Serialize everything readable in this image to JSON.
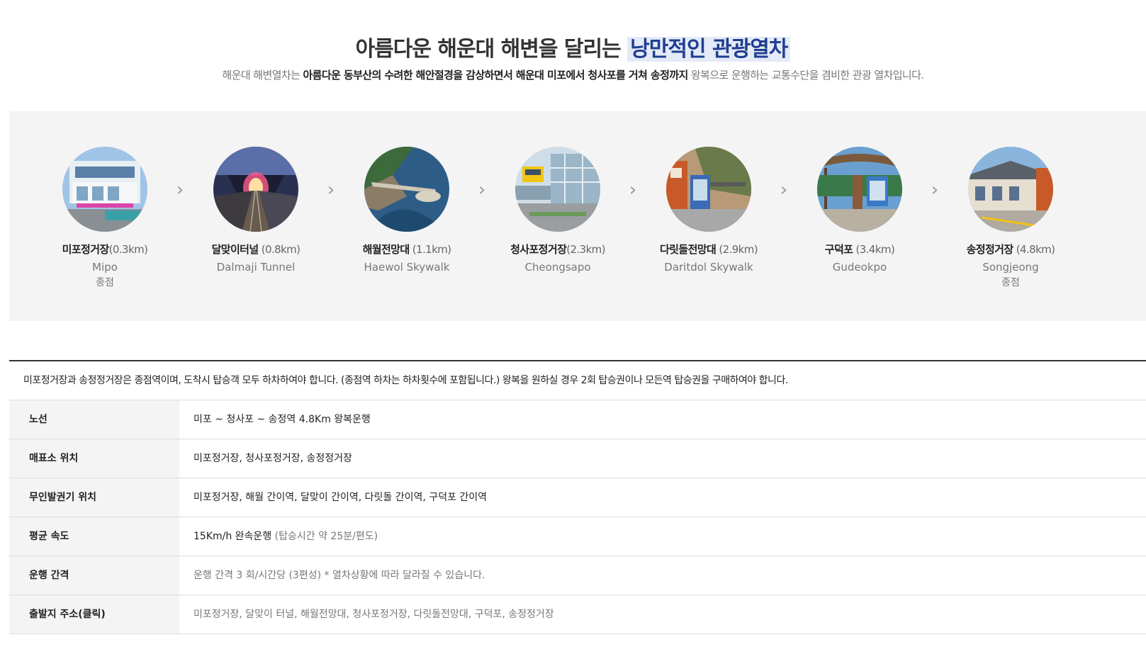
{
  "hero": {
    "title_plain": "아름다운 해운대 해변을 달리는 ",
    "title_highlight": "낭만적인 관광열차",
    "desc_pre": "해운대 해변열차는 ",
    "desc_bold": "아름다운 동부산의 수려한 해안절경을 감상하면서 해운대 미포에서 청사포를 거쳐 송정까지",
    "desc_post": " 왕복으로 운행하는 교통수단을 겸비한 관광 열차입니다."
  },
  "stations": [
    {
      "name": "미포정거장",
      "distance": "(0.3km)",
      "en": "Mipo",
      "term": "종점"
    },
    {
      "name": "달맞이터널",
      "distance": " (0.8km)",
      "en": "Dalmaji Tunnel",
      "term": ""
    },
    {
      "name": "해월전망대",
      "distance": " (1.1km)",
      "en": "Haewol Skywalk",
      "term": ""
    },
    {
      "name": "청사포정거장",
      "distance": "(2.3km)",
      "en": "Cheongsapo",
      "term": ""
    },
    {
      "name": "다릿돌전망대",
      "distance": " (2.9km)",
      "en": "Daritdol Skywalk",
      "term": ""
    },
    {
      "name": "구덕포",
      "distance": " (3.4km)",
      "en": "Gudeokpo",
      "term": ""
    },
    {
      "name": "송정정거장",
      "distance": " (4.8km)",
      "en": "Songjeong",
      "term": "종점"
    }
  ],
  "arrow_glyph": "›",
  "notice": "미포정거장과 송정정거장은 종점역이며, 도착시 탑승객 모두 하차하여야 합니다. (종점역 하차는 하차횟수에 포함됩니다.) 왕복을 원하실 경우 2회 탑승권이나 모든역 탑승권을 구매하여야 합니다.",
  "rows": [
    {
      "label": "노선",
      "value": "미포 ~ 청사포 ~ 송정역 4.8Km 왕복운행"
    },
    {
      "label": "매표소 위치",
      "value": "미포정거장, 청사포정거장, 송정정거장"
    },
    {
      "label": "무인발권기 위치",
      "value": "미포정거장, 해월 간이역, 달맞이 간이역, 다릿돌 간이역, 구덕포 간이역"
    },
    {
      "label": "평균 속도",
      "value": "15Km/h 완속운행",
      "value_extra": " (탑승시간 약 25분/편도)"
    },
    {
      "label": "운행 간격",
      "value": "운행 간격 3 회/시간당 (3편성) * 열차상황에 따라 달라질 수 있습니다."
    },
    {
      "label": "출발지 주소(클릭)",
      "value": "미포정거장, 달맞이 터널, 해월전망대, 청사포정거장, 다릿돌전망대, 구덕포, 송정정거장"
    }
  ],
  "colors": {
    "highlight": "#1f3f8f",
    "panel_bg": "#f4f4f4"
  }
}
